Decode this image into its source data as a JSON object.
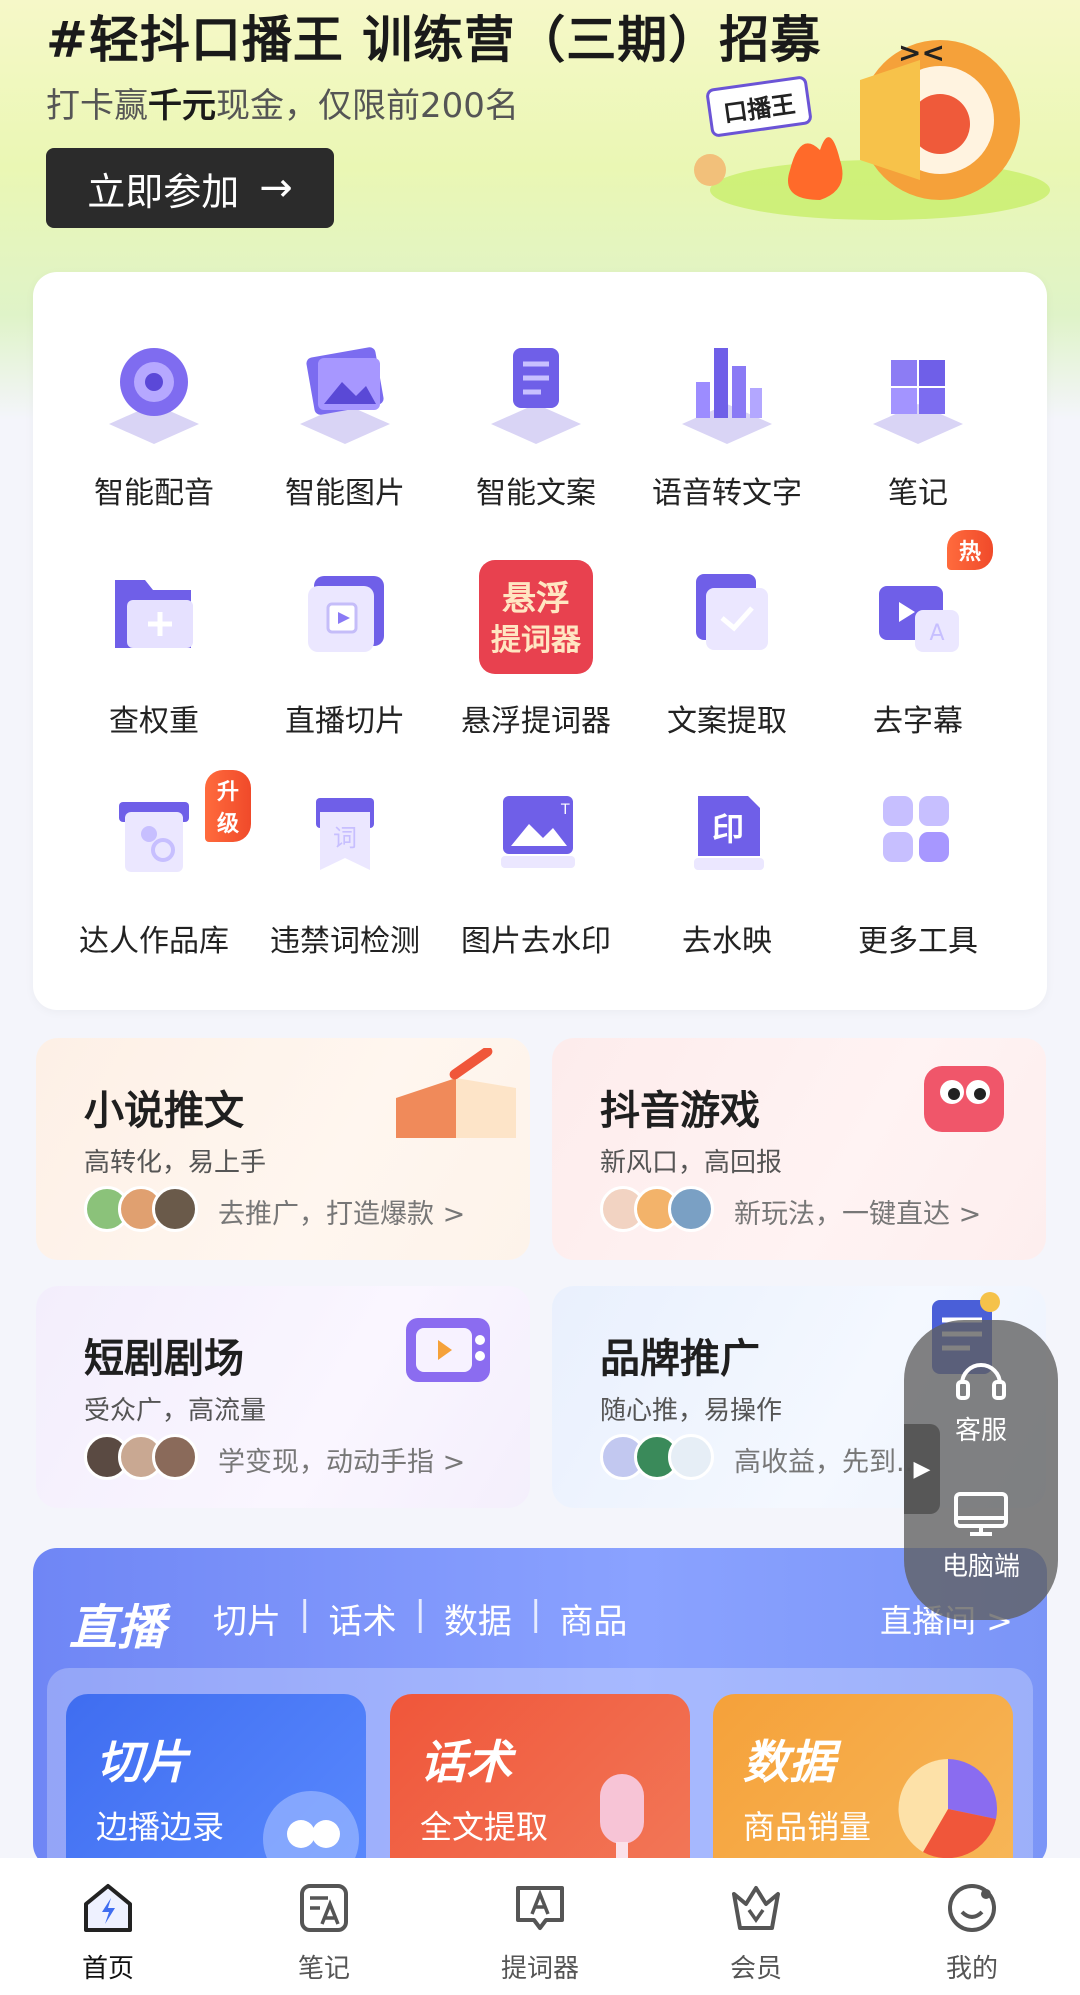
{
  "banner": {
    "title": "#轻抖口播王 训练营（三期）招募",
    "subtitle_prefix": "打卡赢",
    "subtitle_bold": "千元",
    "subtitle_suffix": "现金，仅限前200名",
    "button": "立即参加",
    "badge": "口播王"
  },
  "tools": [
    {
      "label": "智能配音",
      "icon": "speaker-icon"
    },
    {
      "label": "智能图片",
      "icon": "image-icon"
    },
    {
      "label": "智能文案",
      "icon": "pen-icon"
    },
    {
      "label": "语音转文字",
      "icon": "audio-bars-icon"
    },
    {
      "label": "笔记",
      "icon": "cubes-icon"
    },
    {
      "label": "查权重",
      "icon": "folder-icon"
    },
    {
      "label": "直播切片",
      "icon": "play-icon"
    },
    {
      "label": "悬浮提词器",
      "icon": "prompter-icon",
      "icon_text_1": "悬浮",
      "icon_text_2": "提词器"
    },
    {
      "label": "文案提取",
      "icon": "check-doc-icon"
    },
    {
      "label": "去字幕",
      "icon": "subtitle-icon",
      "tag": "热"
    },
    {
      "label": "达人作品库",
      "icon": "library-icon",
      "tag": "升级"
    },
    {
      "label": "违禁词检测",
      "icon": "word-check-icon",
      "icon_text": "词"
    },
    {
      "label": "图片去水印",
      "icon": "image-watermark-icon"
    },
    {
      "label": "去水映",
      "icon": "stamp-icon",
      "icon_text": "印"
    },
    {
      "label": "更多工具",
      "icon": "grid-icon"
    }
  ],
  "categories": [
    {
      "title": "小说推文",
      "sub": "高转化，易上手",
      "cta": "去推广，打造爆款 >"
    },
    {
      "title": "抖音游戏",
      "sub": "新风口，高回报",
      "cta": "新玩法，一键直达 >"
    },
    {
      "title": "短剧剧场",
      "sub": "受众广，高流量",
      "cta": "学变现，动动手指 >"
    },
    {
      "title": "品牌推广",
      "sub": "随心推，易操作",
      "cta": "高收益，先到..."
    }
  ],
  "live": {
    "logo": "直播",
    "tabs": [
      "切片",
      "话术",
      "数据",
      "商品"
    ],
    "more": "直播间 >",
    "cards": [
      {
        "title": "切片",
        "sub": "边播边录"
      },
      {
        "title": "话术",
        "sub": "全文提取"
      },
      {
        "title": "数据",
        "sub": "商品销量"
      }
    ]
  },
  "float": {
    "service": "客服",
    "desktop": "电脑端"
  },
  "nav": [
    {
      "label": "首页",
      "icon": "home-icon",
      "active": true
    },
    {
      "label": "笔记",
      "icon": "note-icon"
    },
    {
      "label": "提词器",
      "icon": "prompter-nav-icon"
    },
    {
      "label": "会员",
      "icon": "crown-icon"
    },
    {
      "label": "我的",
      "icon": "profile-icon"
    }
  ],
  "colors": {
    "accent": "#6b54d6",
    "tag": "#f04a2a",
    "live": "#7b95f7"
  }
}
